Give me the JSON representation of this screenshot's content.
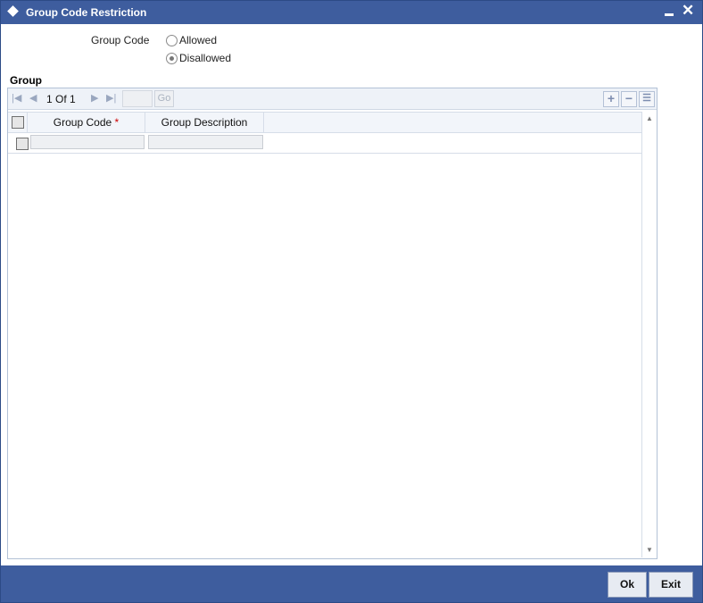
{
  "window": {
    "title": "Group Code Restriction"
  },
  "form": {
    "group_code_label": "Group Code",
    "options": [
      {
        "label": "Allowed",
        "selected": false
      },
      {
        "label": "Disallowed",
        "selected": true
      }
    ]
  },
  "group": {
    "section_title": "Group",
    "pagination": {
      "current": "1",
      "of_label": "Of",
      "total": "1",
      "go_label": "Go"
    },
    "columns": [
      {
        "label": "Group Code",
        "required_mark": "*"
      },
      {
        "label": "Group Description"
      }
    ],
    "rows": [
      {
        "group_code": "",
        "group_description": ""
      }
    ]
  },
  "footer": {
    "ok_label": "Ok",
    "exit_label": "Exit"
  },
  "colors": {
    "titlebar": "#3e5d9e",
    "required": "#cc0000",
    "panel_border": "#b3c2d6"
  }
}
